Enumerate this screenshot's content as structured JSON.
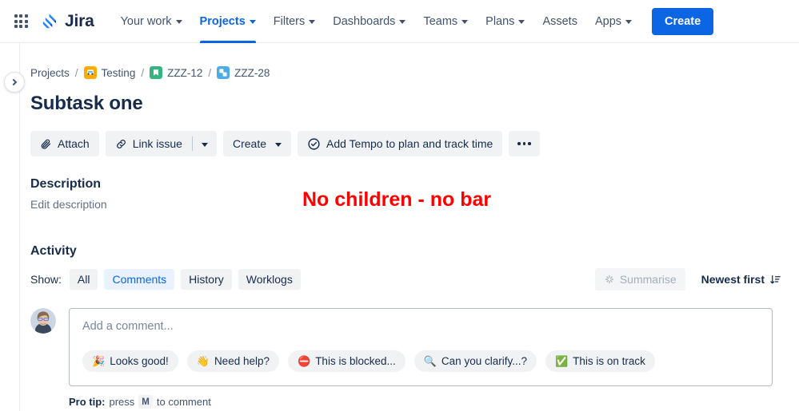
{
  "nav": {
    "app_switcher": "app-switcher",
    "brand": "Jira",
    "items": [
      {
        "label": "Your work",
        "has_caret": true,
        "active": false
      },
      {
        "label": "Projects",
        "has_caret": true,
        "active": true
      },
      {
        "label": "Filters",
        "has_caret": true,
        "active": false
      },
      {
        "label": "Dashboards",
        "has_caret": true,
        "active": false
      },
      {
        "label": "Teams",
        "has_caret": true,
        "active": false
      },
      {
        "label": "Plans",
        "has_caret": true,
        "active": false
      },
      {
        "label": "Assets",
        "has_caret": false,
        "active": false
      },
      {
        "label": "Apps",
        "has_caret": true,
        "active": false
      }
    ],
    "create_label": "Create",
    "create_color": "#0C66E4"
  },
  "breadcrumb": {
    "projects_label": "Projects",
    "separator": "/",
    "project_name": "Testing",
    "parent_issue": "ZZZ-12",
    "current_issue": "ZZZ-28"
  },
  "issue": {
    "title": "Subtask one"
  },
  "toolbar": {
    "attach_label": "Attach",
    "link_issue_label": "Link issue",
    "create_label": "Create",
    "tempo_label": "Add Tempo to plan and track time",
    "more_label": "More actions"
  },
  "description": {
    "heading": "Description",
    "edit_label": "Edit description"
  },
  "annotation": {
    "text": "No children - no bar",
    "color": "#FF0000"
  },
  "activity": {
    "heading": "Activity",
    "show_label": "Show:",
    "filters": [
      {
        "label": "All",
        "selected": false
      },
      {
        "label": "Comments",
        "selected": true
      },
      {
        "label": "History",
        "selected": false
      },
      {
        "label": "Worklogs",
        "selected": false
      }
    ],
    "summarise_label": "Summarise",
    "sort_label": "Newest first"
  },
  "comment": {
    "placeholder": "Add a comment...",
    "quick_replies": [
      {
        "emoji": "🎉",
        "label": "Looks good!"
      },
      {
        "emoji": "👋",
        "label": "Need help?"
      },
      {
        "emoji": "⛔",
        "label": "This is blocked..."
      },
      {
        "emoji": "🔍",
        "label": "Can you clarify...?"
      },
      {
        "emoji": "✅",
        "label": "This is on track"
      }
    ],
    "protip_prefix": "Pro tip:",
    "protip_mid": "press",
    "protip_key": "M",
    "protip_suffix": "to comment"
  }
}
